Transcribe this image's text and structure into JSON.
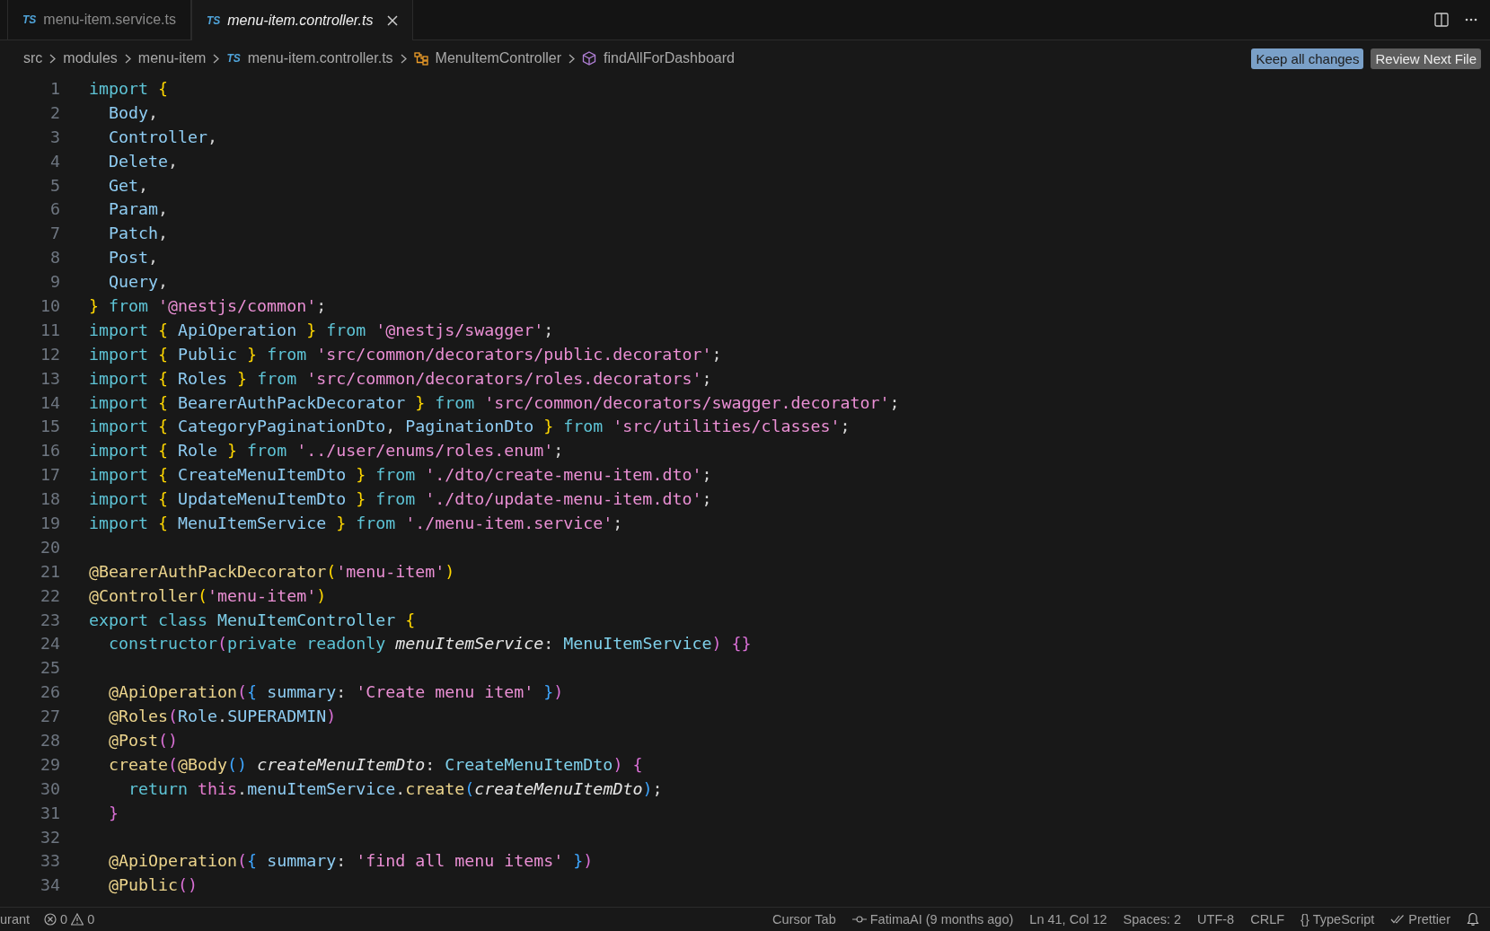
{
  "tabs": [
    {
      "label": "menu-item.service.ts",
      "type_label": "TS",
      "selected": false,
      "preview": false
    },
    {
      "label": "menu-item.controller.ts",
      "type_label": "TS",
      "selected": true,
      "preview": true
    }
  ],
  "breadcrumbs": [
    {
      "kind": "folder",
      "text": "src"
    },
    {
      "kind": "folder",
      "text": "modules"
    },
    {
      "kind": "folder",
      "text": "menu-item"
    },
    {
      "kind": "file",
      "text": "menu-item.controller.ts",
      "type_label": "TS"
    },
    {
      "kind": "class",
      "text": "MenuItemController"
    },
    {
      "kind": "method",
      "text": "findAllForDashboard"
    }
  ],
  "actions": [
    {
      "kind": "primary",
      "label": "Keep all changes"
    },
    {
      "kind": "secondary",
      "label": "Review Next File"
    }
  ],
  "code_lines": [
    {
      "number": "1",
      "tokens": [
        {
          "kind": "kw",
          "text": "import "
        },
        {
          "kind": "b1",
          "text": "{"
        }
      ]
    },
    {
      "number": "2",
      "tokens": [
        {
          "kind": "id",
          "text": "  Body"
        },
        {
          "kind": "plain",
          "text": ","
        }
      ]
    },
    {
      "number": "3",
      "tokens": [
        {
          "kind": "id",
          "text": "  Controller"
        },
        {
          "kind": "plain",
          "text": ","
        }
      ]
    },
    {
      "number": "4",
      "tokens": [
        {
          "kind": "id",
          "text": "  Delete"
        },
        {
          "kind": "plain",
          "text": ","
        }
      ]
    },
    {
      "number": "5",
      "tokens": [
        {
          "kind": "id",
          "text": "  Get"
        },
        {
          "kind": "plain",
          "text": ","
        }
      ]
    },
    {
      "number": "6",
      "tokens": [
        {
          "kind": "id",
          "text": "  Param"
        },
        {
          "kind": "plain",
          "text": ","
        }
      ]
    },
    {
      "number": "7",
      "tokens": [
        {
          "kind": "id",
          "text": "  Patch"
        },
        {
          "kind": "plain",
          "text": ","
        }
      ]
    },
    {
      "number": "8",
      "tokens": [
        {
          "kind": "id",
          "text": "  Post"
        },
        {
          "kind": "plain",
          "text": ","
        }
      ]
    },
    {
      "number": "9",
      "tokens": [
        {
          "kind": "id",
          "text": "  Query"
        },
        {
          "kind": "plain",
          "text": ","
        }
      ]
    },
    {
      "number": "10",
      "tokens": [
        {
          "kind": "b1",
          "text": "} "
        },
        {
          "kind": "kw",
          "text": "from "
        },
        {
          "kind": "str",
          "text": "'@nestjs/common'"
        },
        {
          "kind": "plain",
          "text": ";"
        }
      ]
    },
    {
      "number": "11",
      "tokens": [
        {
          "kind": "kw",
          "text": "import "
        },
        {
          "kind": "b1",
          "text": "{ "
        },
        {
          "kind": "id",
          "text": "ApiOperation "
        },
        {
          "kind": "b1",
          "text": "} "
        },
        {
          "kind": "kw",
          "text": "from "
        },
        {
          "kind": "str",
          "text": "'@nestjs/swagger'"
        },
        {
          "kind": "plain",
          "text": ";"
        }
      ]
    },
    {
      "number": "12",
      "tokens": [
        {
          "kind": "kw",
          "text": "import "
        },
        {
          "kind": "b1",
          "text": "{ "
        },
        {
          "kind": "id",
          "text": "Public "
        },
        {
          "kind": "b1",
          "text": "} "
        },
        {
          "kind": "kw",
          "text": "from "
        },
        {
          "kind": "str",
          "text": "'src/common/decorators/public.decorator'"
        },
        {
          "kind": "plain",
          "text": ";"
        }
      ]
    },
    {
      "number": "13",
      "tokens": [
        {
          "kind": "kw",
          "text": "import "
        },
        {
          "kind": "b1",
          "text": "{ "
        },
        {
          "kind": "id",
          "text": "Roles "
        },
        {
          "kind": "b1",
          "text": "} "
        },
        {
          "kind": "kw",
          "text": "from "
        },
        {
          "kind": "str",
          "text": "'src/common/decorators/roles.decorators'"
        },
        {
          "kind": "plain",
          "text": ";"
        }
      ]
    },
    {
      "number": "14",
      "tokens": [
        {
          "kind": "kw",
          "text": "import "
        },
        {
          "kind": "b1",
          "text": "{ "
        },
        {
          "kind": "id",
          "text": "BearerAuthPackDecorator "
        },
        {
          "kind": "b1",
          "text": "} "
        },
        {
          "kind": "kw",
          "text": "from "
        },
        {
          "kind": "str",
          "text": "'src/common/decorators/swagger.decorator'"
        },
        {
          "kind": "plain",
          "text": ";"
        }
      ]
    },
    {
      "number": "15",
      "tokens": [
        {
          "kind": "kw",
          "text": "import "
        },
        {
          "kind": "b1",
          "text": "{ "
        },
        {
          "kind": "id",
          "text": "CategoryPaginationDto"
        },
        {
          "kind": "plain",
          "text": ", "
        },
        {
          "kind": "id",
          "text": "PaginationDto "
        },
        {
          "kind": "b1",
          "text": "} "
        },
        {
          "kind": "kw",
          "text": "from "
        },
        {
          "kind": "str",
          "text": "'src/utilities/classes'"
        },
        {
          "kind": "plain",
          "text": ";"
        }
      ]
    },
    {
      "number": "16",
      "tokens": [
        {
          "kind": "kw",
          "text": "import "
        },
        {
          "kind": "b1",
          "text": "{ "
        },
        {
          "kind": "id",
          "text": "Role "
        },
        {
          "kind": "b1",
          "text": "} "
        },
        {
          "kind": "kw",
          "text": "from "
        },
        {
          "kind": "str",
          "text": "'../user/enums/roles.enum'"
        },
        {
          "kind": "plain",
          "text": ";"
        }
      ]
    },
    {
      "number": "17",
      "tokens": [
        {
          "kind": "kw",
          "text": "import "
        },
        {
          "kind": "b1",
          "text": "{ "
        },
        {
          "kind": "id",
          "text": "CreateMenuItemDto "
        },
        {
          "kind": "b1",
          "text": "} "
        },
        {
          "kind": "kw",
          "text": "from "
        },
        {
          "kind": "str",
          "text": "'./dto/create-menu-item.dto'"
        },
        {
          "kind": "plain",
          "text": ";"
        }
      ]
    },
    {
      "number": "18",
      "tokens": [
        {
          "kind": "kw",
          "text": "import "
        },
        {
          "kind": "b1",
          "text": "{ "
        },
        {
          "kind": "id",
          "text": "UpdateMenuItemDto "
        },
        {
          "kind": "b1",
          "text": "} "
        },
        {
          "kind": "kw",
          "text": "from "
        },
        {
          "kind": "str",
          "text": "'./dto/update-menu-item.dto'"
        },
        {
          "kind": "plain",
          "text": ";"
        }
      ]
    },
    {
      "number": "19",
      "tokens": [
        {
          "kind": "kw",
          "text": "import "
        },
        {
          "kind": "b1",
          "text": "{ "
        },
        {
          "kind": "id",
          "text": "MenuItemService "
        },
        {
          "kind": "b1",
          "text": "} "
        },
        {
          "kind": "kw",
          "text": "from "
        },
        {
          "kind": "str",
          "text": "'./menu-item.service'"
        },
        {
          "kind": "plain",
          "text": ";"
        }
      ]
    },
    {
      "number": "20"
    },
    {
      "number": "21",
      "tokens": [
        {
          "kind": "fn",
          "text": "@BearerAuthPackDecorator"
        },
        {
          "kind": "b1",
          "text": "("
        },
        {
          "kind": "str",
          "text": "'menu-item'"
        },
        {
          "kind": "b1",
          "text": ")"
        }
      ]
    },
    {
      "number": "22",
      "tokens": [
        {
          "kind": "fn",
          "text": "@Controller"
        },
        {
          "kind": "b1",
          "text": "("
        },
        {
          "kind": "str",
          "text": "'menu-item'"
        },
        {
          "kind": "b1",
          "text": ")"
        }
      ]
    },
    {
      "number": "23",
      "tokens": [
        {
          "kind": "kw",
          "text": "export class "
        },
        {
          "kind": "type",
          "text": "MenuItemController "
        },
        {
          "kind": "b1",
          "text": "{"
        }
      ]
    },
    {
      "number": "24",
      "tokens": [
        {
          "kind": "kw",
          "text": "  constructor"
        },
        {
          "kind": "b2",
          "text": "("
        },
        {
          "kind": "kw",
          "text": "private readonly "
        },
        {
          "kind": "param",
          "text": "menuItemService"
        },
        {
          "kind": "plain",
          "text": ": "
        },
        {
          "kind": "type",
          "text": "MenuItemService"
        },
        {
          "kind": "b2",
          "text": ") {}"
        }
      ]
    },
    {
      "number": "25"
    },
    {
      "number": "26",
      "tokens": [
        {
          "kind": "fn",
          "text": "  @ApiOperation"
        },
        {
          "kind": "b2",
          "text": "("
        },
        {
          "kind": "b3",
          "text": "{ "
        },
        {
          "kind": "id",
          "text": "summary"
        },
        {
          "kind": "plain",
          "text": ": "
        },
        {
          "kind": "str",
          "text": "'Create menu item'"
        },
        {
          "kind": "b3",
          "text": " }"
        },
        {
          "kind": "b2",
          "text": ")"
        }
      ]
    },
    {
      "number": "27",
      "tokens": [
        {
          "kind": "fn",
          "text": "  @Roles"
        },
        {
          "kind": "b2",
          "text": "("
        },
        {
          "kind": "id",
          "text": "Role"
        },
        {
          "kind": "plain",
          "text": "."
        },
        {
          "kind": "id",
          "text": "SUPERADMIN"
        },
        {
          "kind": "b2",
          "text": ")"
        }
      ]
    },
    {
      "number": "28",
      "tokens": [
        {
          "kind": "fn",
          "text": "  @Post"
        },
        {
          "kind": "b2",
          "text": "()"
        }
      ]
    },
    {
      "number": "29",
      "tokens": [
        {
          "kind": "fn",
          "text": "  create"
        },
        {
          "kind": "b2",
          "text": "("
        },
        {
          "kind": "fn",
          "text": "@Body"
        },
        {
          "kind": "b3",
          "text": "() "
        },
        {
          "kind": "param",
          "text": "createMenuItemDto"
        },
        {
          "kind": "plain",
          "text": ": "
        },
        {
          "kind": "type",
          "text": "CreateMenuItemDto"
        },
        {
          "kind": "b2",
          "text": ") {"
        }
      ]
    },
    {
      "number": "30",
      "tokens": [
        {
          "kind": "kw",
          "text": "    return "
        },
        {
          "kind": "this",
          "text": "this"
        },
        {
          "kind": "plain",
          "text": "."
        },
        {
          "kind": "id",
          "text": "menuItemService"
        },
        {
          "kind": "plain",
          "text": "."
        },
        {
          "kind": "fn",
          "text": "create"
        },
        {
          "kind": "b3",
          "text": "("
        },
        {
          "kind": "param",
          "text": "createMenuItemDto"
        },
        {
          "kind": "b3",
          "text": ")"
        },
        {
          "kind": "plain",
          "text": ";"
        }
      ]
    },
    {
      "number": "31",
      "tokens": [
        {
          "kind": "b2",
          "text": "  }"
        }
      ]
    },
    {
      "number": "32"
    },
    {
      "number": "33",
      "tokens": [
        {
          "kind": "fn",
          "text": "  @ApiOperation"
        },
        {
          "kind": "b2",
          "text": "("
        },
        {
          "kind": "b3",
          "text": "{ "
        },
        {
          "kind": "id",
          "text": "summary"
        },
        {
          "kind": "plain",
          "text": ": "
        },
        {
          "kind": "str",
          "text": "'find all menu items'"
        },
        {
          "kind": "b3",
          "text": " }"
        },
        {
          "kind": "b2",
          "text": ")"
        }
      ]
    },
    {
      "number": "34",
      "tokens": [
        {
          "kind": "fn",
          "text": "  @Public"
        },
        {
          "kind": "b2",
          "text": "()"
        }
      ]
    }
  ],
  "status_bar": {
    "left": [
      {
        "kind": "text",
        "text": "urant"
      },
      {
        "kind": "problems",
        "errors": "0",
        "warnings": "0"
      }
    ],
    "right": [
      {
        "kind": "text",
        "text": "Cursor Tab"
      },
      {
        "kind": "commit",
        "text": "FatimaAI (9 months ago)"
      },
      {
        "kind": "text",
        "text": "Ln 41, Col 12"
      },
      {
        "kind": "text",
        "text": "Spaces: 2"
      },
      {
        "kind": "text",
        "text": "UTF-8"
      },
      {
        "kind": "text",
        "text": "CRLF"
      },
      {
        "kind": "language",
        "text": "TypeScript",
        "glyph": "{}"
      },
      {
        "kind": "check",
        "text": "Prettier"
      },
      {
        "kind": "bell"
      }
    ]
  }
}
